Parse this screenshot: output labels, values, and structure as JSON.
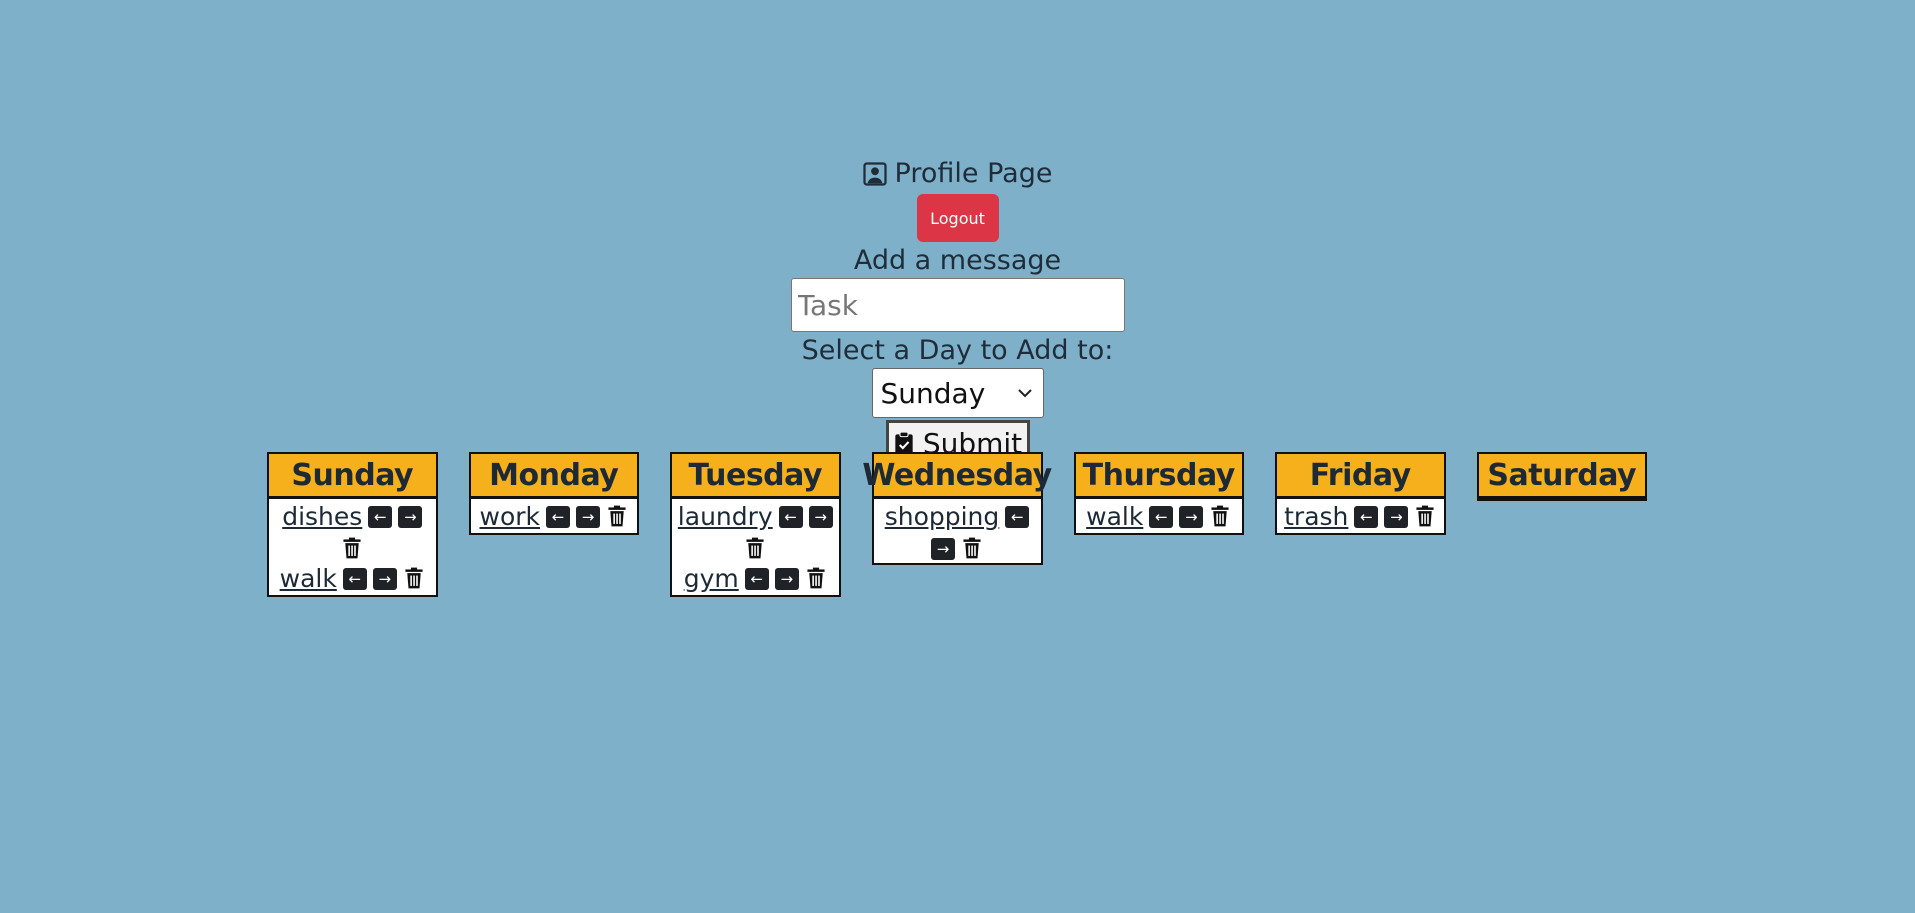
{
  "profile": {
    "title": "Profile Page",
    "icon": "user-square-icon"
  },
  "logout": {
    "label": "Logout",
    "color": "#dc3545"
  },
  "add_message": {
    "label": "Add a message",
    "placeholder": "Task",
    "value": ""
  },
  "day_select": {
    "label": "Select a Day to Add to:",
    "selected": "Sunday"
  },
  "submit": {
    "label": "Submit",
    "icon": "clipboard-check-icon"
  },
  "colors": {
    "background": "#7fb0c9",
    "day_header": "#f6b01b"
  },
  "days": [
    {
      "name": "Sunday",
      "tasks": [
        "dishes",
        "walk"
      ]
    },
    {
      "name": "Monday",
      "tasks": [
        "work"
      ]
    },
    {
      "name": "Tuesday",
      "tasks": [
        "laundry",
        "gym"
      ]
    },
    {
      "name": "Wednesday",
      "tasks": [
        "shopping"
      ]
    },
    {
      "name": "Thursday",
      "tasks": [
        "walk"
      ]
    },
    {
      "name": "Friday",
      "tasks": [
        "trash"
      ]
    },
    {
      "name": "Saturday",
      "tasks": []
    }
  ],
  "task_controls": {
    "left": "←",
    "right": "→",
    "trash_icon": "trash-icon"
  }
}
